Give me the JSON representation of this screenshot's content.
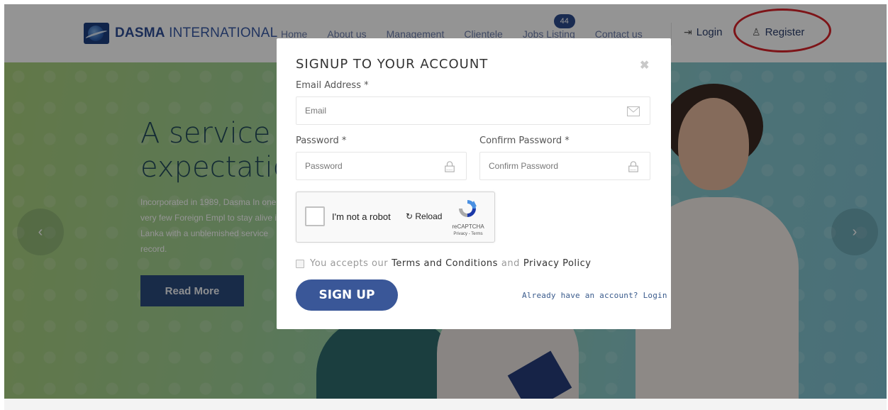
{
  "brand": {
    "name_bold": "DASMA",
    "name_rest": " INTERNATIONAL"
  },
  "nav": {
    "items": [
      "Home",
      "About us",
      "Management",
      "Clientele",
      "Jobs Listing",
      "Contact us"
    ],
    "jobs_badge": "44",
    "login": "Login",
    "register": "Register"
  },
  "hero": {
    "title_line1": "A service b",
    "title_line2": "expectatio",
    "text": "Incorporated in 1989, Dasma In one of a very few Foreign Empl to stay alive in Sri Lanka with a unblemished service record.",
    "read_more": "Read More",
    "arrow_left": "‹",
    "arrow_right": "›"
  },
  "modal": {
    "title": "SIGNUP TO YOUR ACCOUNT",
    "close": "✖",
    "email_label": "Email Address *",
    "email_placeholder": "Email",
    "password_label": "Password *",
    "password_placeholder": "Password",
    "confirm_label": "Confirm Password *",
    "confirm_placeholder": "Confirm Password",
    "captcha": {
      "label": "I'm not a robot",
      "reload": "Reload",
      "brand": "reCAPTCHA",
      "links": "Privacy - Terms"
    },
    "terms": {
      "prefix": "You accepts our",
      "terms_link": "Terms and Conditions",
      "and": "and",
      "privacy_link": "Privacy Policy"
    },
    "signup_button": "SIGN UP",
    "login_prompt": "Already have an account? Login"
  },
  "colors": {
    "brand_blue": "#2f4f96",
    "signup_blue": "#3a5798",
    "highlight_red": "#d8232a"
  }
}
